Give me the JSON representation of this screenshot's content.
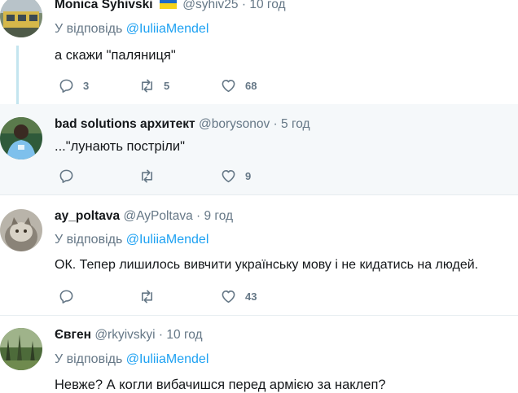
{
  "colors": {
    "accent": "#1da1f2",
    "muted": "#657786",
    "thread_line": "#c4e5ef",
    "flag_blue": "#1d6ac7",
    "flag_yellow": "#f5d21a"
  },
  "tweets": [
    {
      "name": "Monica Syhivski",
      "flag_icon": "ukraine-flag-icon",
      "handle": "@syhiv25",
      "dot": "·",
      "time": "10 год",
      "reply_prefix": "У відповідь",
      "reply_mention": "@IuliiaMendel",
      "text": "а скажи \"паляниця\"",
      "replies": "3",
      "retweets": "5",
      "likes": "68"
    },
    {
      "name": "bad solutions архитект",
      "handle": "@borysonov",
      "dot": "·",
      "time": "5 год",
      "text": "...\"лунають постріли\"",
      "replies": "",
      "retweets": "",
      "likes": "9"
    },
    {
      "name": "ay_poltava",
      "handle": "@AyPoltava",
      "dot": "·",
      "time": "9 год",
      "reply_prefix": "У відповідь",
      "reply_mention": "@IuliiaMendel",
      "text": "ОК. Тепер лишилось вивчити українську мову і не кидатись на людей.",
      "replies": "",
      "retweets": "",
      "likes": "43"
    },
    {
      "name": "Євген",
      "handle": "@rkyivskyi",
      "dot": "·",
      "time": "10 год",
      "reply_prefix": "У відповідь",
      "reply_mention": "@IuliiaMendel",
      "text": "Невже? А когли вибачишся перед армією за наклеп?"
    }
  ],
  "icons": {
    "reply": "reply-icon",
    "retweet": "retweet-icon",
    "like": "heart-icon"
  }
}
